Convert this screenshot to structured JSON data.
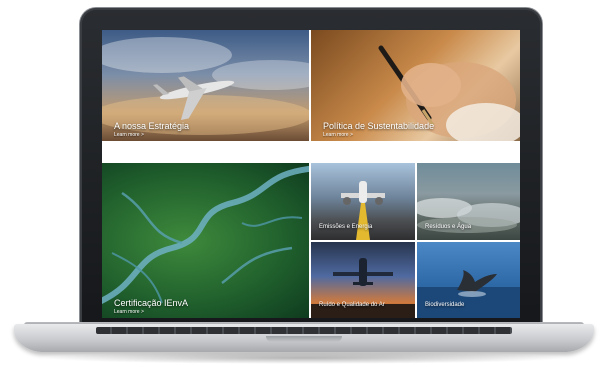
{
  "tiles": {
    "strategy": {
      "title": "A nossa Estratégia",
      "cta": "Learn more >"
    },
    "sustainability": {
      "title": "Política de Sustentabilidade",
      "cta": "Learn more >"
    },
    "certification": {
      "title": "Certificação IEnvA",
      "cta": "Learn more >"
    },
    "emissions": {
      "title": "Emissões e Energia"
    },
    "waste": {
      "title": "Resíduos e Água"
    },
    "air_quality": {
      "title": "Ruído e Qualidade do Ar"
    },
    "biodiversity": {
      "title": "Biodiversidade"
    }
  },
  "colors": {
    "bezel": "#1b1d20",
    "aluminium": "#c9cbce",
    "caption_text": "#ffffff"
  }
}
